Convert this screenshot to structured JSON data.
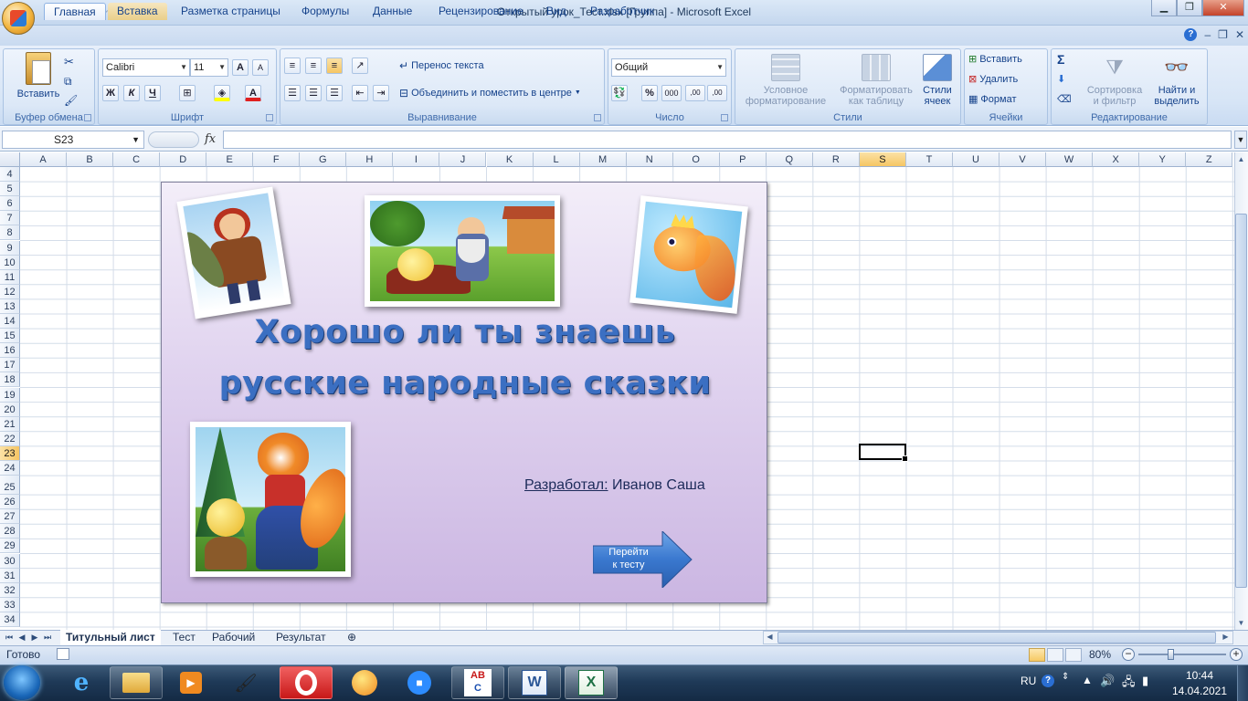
{
  "window": {
    "title": "Открытый урок_Тест.xlsx  [Группа] - Microsoft Excel",
    "min": "▁",
    "max": "❐",
    "close": "✕"
  },
  "ribbon_tabs": [
    "Главная",
    "Вставка",
    "Разметка страницы",
    "Формулы",
    "Данные",
    "Рецензирование",
    "Вид",
    "Разработчик"
  ],
  "ribbon_right": {
    "help": "?",
    "min": "–",
    "restore": "❐",
    "close": "✕"
  },
  "clipboard": {
    "paste": "Вставить",
    "label": "Буфер обмена"
  },
  "font": {
    "name": "Calibri",
    "size": "11",
    "grow": "A",
    "shrink": "A",
    "bold": "Ж",
    "italic": "К",
    "underline": "Ч",
    "color_letter": "A",
    "label": "Шрифт"
  },
  "alignment": {
    "wrap": "Перенос текста",
    "merge": "Объединить и поместить в центре",
    "label": "Выравнивание"
  },
  "number": {
    "format": "Общий",
    "percent": "%",
    "thousands": "000",
    "inc": ",00",
    "dec": ",00",
    "label": "Число"
  },
  "styles": {
    "conditional": [
      "Условное",
      "форматирование"
    ],
    "as_table": [
      "Форматировать",
      "как таблицу"
    ],
    "cell_styles": [
      "Стили",
      "ячеек"
    ],
    "label": "Стили"
  },
  "cells": {
    "insert": "Вставить",
    "delete": "Удалить",
    "format": "Формат",
    "label": "Ячейки"
  },
  "editing": {
    "sigma": "Σ",
    "sort": [
      "Сортировка",
      "и фильтр"
    ],
    "find": [
      "Найти и",
      "выделить"
    ],
    "label": "Редактирование"
  },
  "formula_bar": {
    "name_box": "S23",
    "fx": "fx",
    "value": ""
  },
  "columns": [
    "A",
    "B",
    "C",
    "D",
    "E",
    "F",
    "G",
    "H",
    "I",
    "J",
    "K",
    "L",
    "M",
    "N",
    "O",
    "P",
    "Q",
    "R",
    "S",
    "T",
    "U",
    "V",
    "W",
    "X",
    "Y",
    "Z"
  ],
  "rows": [
    "4",
    "5",
    "6",
    "7",
    "8",
    "9",
    "10",
    "11",
    "12",
    "13",
    "14",
    "15",
    "16",
    "17",
    "18",
    "19",
    "20",
    "21",
    "22",
    "23",
    "24",
    "25",
    "26",
    "27",
    "28",
    "29",
    "30",
    "31",
    "32",
    "33",
    "34"
  ],
  "selected": {
    "column": "S",
    "row": "23"
  },
  "slide": {
    "title_line1": "Хорошо ли ты знаешь",
    "title_line2": "русские народные сказки",
    "author_label": "Разработал:",
    "author_name": " Иванов Саша",
    "button_label_1": "Перейти",
    "button_label_2": "к тесту",
    "title_color": "#3b6fc2"
  },
  "sheet_tabs": [
    "Титульный лист",
    "Тест",
    "Рабочий",
    "Результат"
  ],
  "status": {
    "ready": "Готово",
    "zoom": "80%"
  },
  "taskbar": {
    "lang": "RU",
    "time": "10:44",
    "date": "14.04.2021"
  }
}
